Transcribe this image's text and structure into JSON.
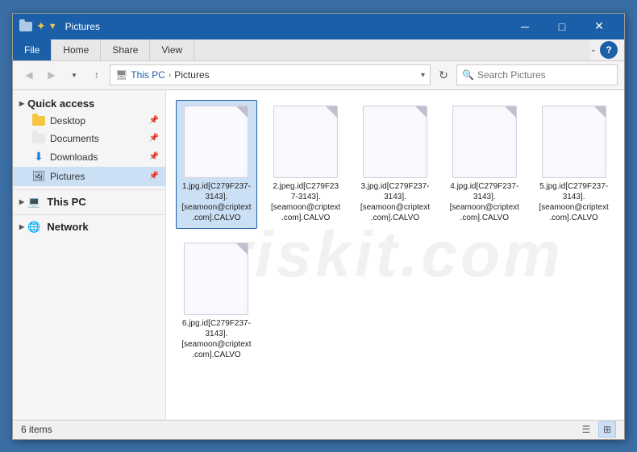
{
  "window": {
    "title": "Pictures",
    "title_bar_bg": "#1a5fa8"
  },
  "ribbon": {
    "tabs": [
      "File",
      "Home",
      "Share",
      "View"
    ],
    "active_tab": "File"
  },
  "address_bar": {
    "breadcrumb": [
      "This PC",
      "Pictures"
    ],
    "search_placeholder": "Search Pictures",
    "search_value": ""
  },
  "sidebar": {
    "quick_access_label": "Quick access",
    "items": [
      {
        "label": "Desktop",
        "pinned": true,
        "type": "desktop"
      },
      {
        "label": "Documents",
        "pinned": true,
        "type": "docs"
      },
      {
        "label": "Downloads",
        "pinned": true,
        "type": "downloads"
      },
      {
        "label": "Pictures",
        "pinned": true,
        "type": "pictures",
        "active": true
      }
    ],
    "section2": "This PC",
    "section3": "Network"
  },
  "files": [
    {
      "name": "1.jpg.id[C279F237-3143].[seamoon@criptext.com].CALVO",
      "display_name": "1.jpg.id[C279F237-3143].[seamoon@criptext.com].CALVO"
    },
    {
      "name": "2.jpeg.id[C279F237-3143].[seamoon@criptext.com].CALVO",
      "display_name": "2.jpeg.id[C279F237-3143].[seamoon@criptext.com].CALVO"
    },
    {
      "name": "3.jpg.id[C279F237-3143].[seamoon@criptext.com].CALVO",
      "display_name": "3.jpg.id[C279F237-3143].[seamoon@criptext.com].CALVO"
    },
    {
      "name": "4.jpg.id[C279F237-3143].[seamoon@criptext.com].CALVO",
      "display_name": "4.jpg.id[C279F237-3143].[seamoon@criptext.com].CALVO"
    },
    {
      "name": "5.jpg.id[C279F237-3143].[seamoon@criptext.com].CALVO",
      "display_name": "5.jpg.id[C279F237-3143].[seamoon@criptext.com].CALVO"
    },
    {
      "name": "6.jpg.id[C279F237-3143].[seamoon@criptext.com].CALVO",
      "display_name": "6.jpg.id[C279F237-3143].[seamoon@criptext.com].CALVO"
    }
  ],
  "status_bar": {
    "items_count": "6 items"
  },
  "watermark": "riskit.com"
}
